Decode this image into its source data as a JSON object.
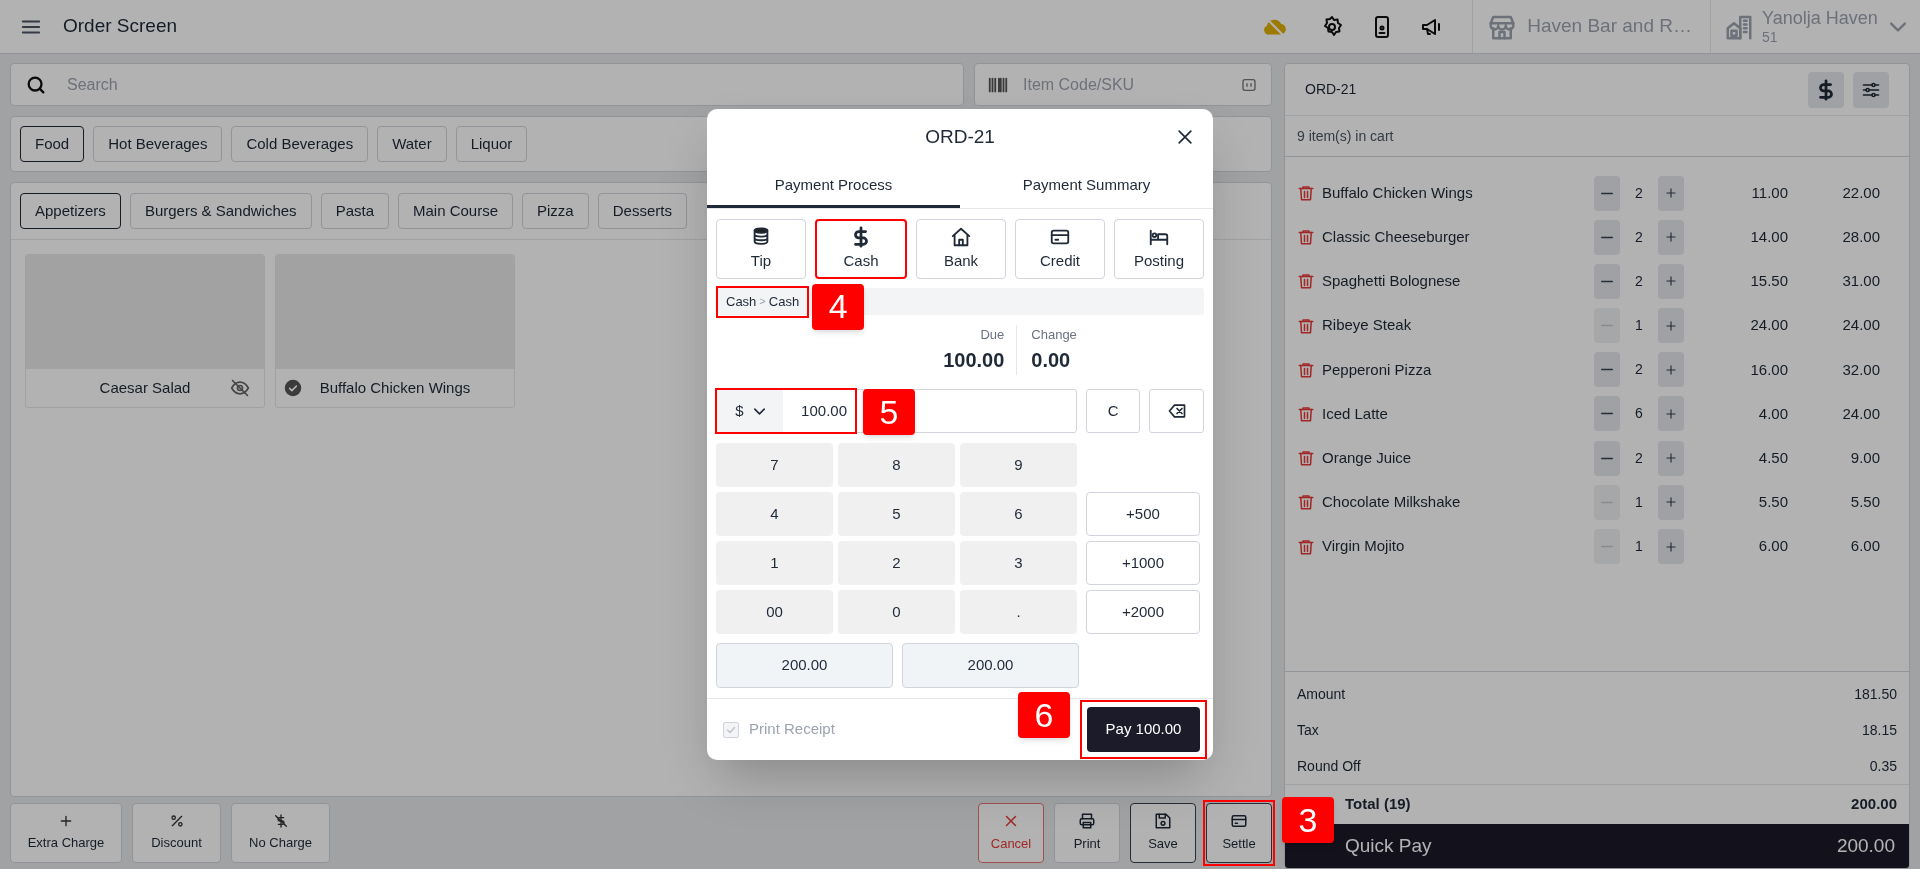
{
  "top_bar": {
    "title": "Order Screen",
    "store": "Haven Bar and R…",
    "property": "Yanolja Haven",
    "property_code": "51"
  },
  "search": {
    "placeholder": "Search"
  },
  "sku_field": {
    "placeholder": "Item Code/SKU"
  },
  "categories": [
    {
      "label": "Food",
      "selected": true
    },
    {
      "label": "Hot Beverages",
      "selected": false
    },
    {
      "label": "Cold Beverages",
      "selected": false
    },
    {
      "label": "Water",
      "selected": false
    },
    {
      "label": "Liquor",
      "selected": false
    }
  ],
  "subcategories": [
    {
      "label": "Appetizers",
      "selected": true
    },
    {
      "label": "Burgers & Sandwiches",
      "selected": false
    },
    {
      "label": "Pasta",
      "selected": false
    },
    {
      "label": "Main Course",
      "selected": false
    },
    {
      "label": "Pizza",
      "selected": false
    },
    {
      "label": "Desserts",
      "selected": false
    }
  ],
  "menu_items": [
    {
      "name": "Caesar Salad",
      "hidden": true,
      "in_cart": false
    },
    {
      "name": "Buffalo Chicken Wings",
      "hidden": false,
      "in_cart": true
    }
  ],
  "actions_left": [
    {
      "label": "Extra Charge",
      "kind": "plus"
    },
    {
      "label": "Discount",
      "kind": "percent"
    },
    {
      "label": "No Charge",
      "kind": "no-charge"
    }
  ],
  "actions_right": [
    {
      "label": "Cancel",
      "kind": "cancel"
    },
    {
      "label": "Print",
      "kind": "print"
    },
    {
      "label": "Save",
      "kind": "save"
    },
    {
      "label": "Settle",
      "kind": "settle",
      "highlighted": true,
      "callout": "3"
    }
  ],
  "cart": {
    "order": "ORD-21",
    "count_text": "9 item(s) in cart",
    "items": [
      {
        "name": "Buffalo Chicken Wings",
        "qty": "2",
        "price": "11.00",
        "total": "22.00",
        "can_decrease": true
      },
      {
        "name": "Classic Cheeseburger",
        "qty": "2",
        "price": "14.00",
        "total": "28.00",
        "can_decrease": true
      },
      {
        "name": "Spaghetti Bolognese",
        "qty": "2",
        "price": "15.50",
        "total": "31.00",
        "can_decrease": true
      },
      {
        "name": "Ribeye Steak",
        "qty": "1",
        "price": "24.00",
        "total": "24.00",
        "can_decrease": false
      },
      {
        "name": "Pepperoni Pizza",
        "qty": "2",
        "price": "16.00",
        "total": "32.00",
        "can_decrease": true
      },
      {
        "name": "Iced Latte",
        "qty": "6",
        "price": "4.00",
        "total": "24.00",
        "can_decrease": true
      },
      {
        "name": "Orange Juice",
        "qty": "2",
        "price": "4.50",
        "total": "9.00",
        "can_decrease": true
      },
      {
        "name": "Chocolate Milkshake",
        "qty": "1",
        "price": "5.50",
        "total": "5.50",
        "can_decrease": false
      },
      {
        "name": "Virgin Mojito",
        "qty": "1",
        "price": "6.00",
        "total": "6.00",
        "can_decrease": false
      }
    ],
    "summary": [
      {
        "label": "Amount",
        "value": "181.50"
      },
      {
        "label": "Tax",
        "value": "18.15"
      },
      {
        "label": "Round Off",
        "value": "0.35"
      }
    ],
    "total": {
      "label": "Total (19)",
      "value": "200.00"
    },
    "quick_pay": {
      "label": "Quick Pay",
      "value": "200.00"
    }
  },
  "modal": {
    "title": "ORD-21",
    "tabs": [
      {
        "label": "Payment Process",
        "selected": true
      },
      {
        "label": "Payment Summary",
        "selected": false
      }
    ],
    "methods": [
      {
        "label": "Tip",
        "kind": "tip",
        "selected": false
      },
      {
        "label": "Cash",
        "kind": "cash",
        "selected": true
      },
      {
        "label": "Bank",
        "kind": "bank",
        "selected": false
      },
      {
        "label": "Credit",
        "kind": "credit",
        "selected": false
      },
      {
        "label": "Posting",
        "kind": "posting",
        "selected": false
      }
    ],
    "breadcrumb": {
      "parent": "Cash",
      "separator": ">",
      "child": "Cash",
      "highlighted": true,
      "callout": "4"
    },
    "due": {
      "label": "Due",
      "value": "100.00"
    },
    "change": {
      "label": "Change",
      "value": "0.00"
    },
    "amount": {
      "currency": "$",
      "value": "100.00",
      "highlighted": true,
      "callout": "5"
    },
    "clear_key": "C",
    "keypad": [
      "7",
      "8",
      "9",
      "4",
      "5",
      "6",
      "1",
      "2",
      "3",
      "00",
      "0",
      "."
    ],
    "quick_amounts": [
      "+500",
      "+1000",
      "+2000"
    ],
    "suggested": [
      "200.00",
      "200.00"
    ],
    "print_receipt": {
      "label": "Print Receipt",
      "checked": true,
      "disabled": true
    },
    "pay_button": {
      "label": "Pay 100.00",
      "highlighted": true,
      "callout": "6"
    }
  }
}
